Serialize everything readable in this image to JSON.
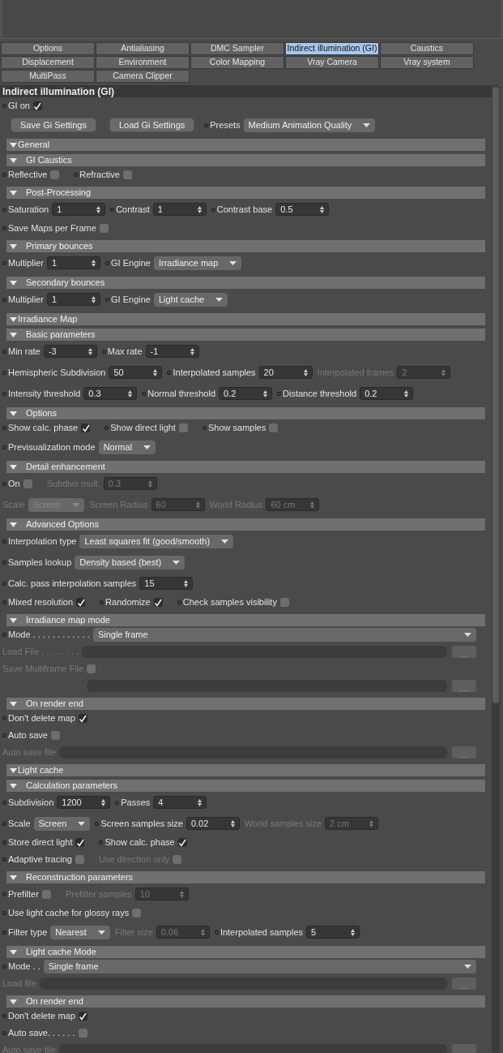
{
  "tabs": [
    {
      "label": "Options",
      "selected": false
    },
    {
      "label": "Antialiasing",
      "selected": false
    },
    {
      "label": "DMC Sampler",
      "selected": false
    },
    {
      "label": "Indirect illumination (GI)",
      "selected": true
    },
    {
      "label": "Caustics",
      "selected": false
    },
    {
      "label": "Displacement",
      "selected": false
    },
    {
      "label": "Environment",
      "selected": false
    },
    {
      "label": "Color Mapping",
      "selected": false
    },
    {
      "label": "Vray Camera",
      "selected": false
    },
    {
      "label": "Vray system",
      "selected": false
    },
    {
      "label": "MultiPass",
      "selected": false
    },
    {
      "label": "Camera Clipper",
      "selected": false
    }
  ],
  "panel_title": "Indirect illumination (GI)",
  "blocks": [
    {
      "kind": "row",
      "items": [
        {
          "kind": "checkbox",
          "label": "GI on",
          "checked": true,
          "disabled": false
        }
      ]
    },
    {
      "kind": "row",
      "items": [
        {
          "kind": "button",
          "label": "Save Gi Settings"
        },
        {
          "kind": "button",
          "label": "Load Gi Settings"
        },
        {
          "kind": "dropdown",
          "label": "Presets",
          "value": "Medium Animation Quality",
          "disabled": false
        }
      ]
    },
    {
      "kind": "group",
      "label": "General"
    },
    {
      "kind": "subgroup",
      "label": "GI Caustics"
    },
    {
      "kind": "row",
      "items": [
        {
          "kind": "checkbox",
          "label": "Reflective",
          "checked": false,
          "disabled": false
        },
        {
          "kind": "checkbox",
          "label": "Refractive",
          "checked": false,
          "disabled": false
        }
      ]
    },
    {
      "kind": "subgroup",
      "label": "Post-Processing"
    },
    {
      "kind": "row",
      "items": [
        {
          "kind": "spinner",
          "label": "Saturation",
          "value": "1",
          "disabled": false
        },
        {
          "kind": "spinner",
          "label": "Contrast",
          "value": "1",
          "disabled": false
        },
        {
          "kind": "spinner",
          "label": "Contrast base",
          "value": "0.5",
          "disabled": false
        }
      ]
    },
    {
      "kind": "row",
      "items": [
        {
          "kind": "checkbox",
          "label": "Save Maps per Frame",
          "checked": false,
          "disabled": false
        }
      ]
    },
    {
      "kind": "subgroup",
      "label": "Primary bounces"
    },
    {
      "kind": "row",
      "items": [
        {
          "kind": "spinner",
          "label": "Multiplier",
          "value": "1",
          "disabled": false
        },
        {
          "kind": "dropdown",
          "label": "GI Engine",
          "value": "Irradiance map",
          "disabled": false
        }
      ]
    },
    {
      "kind": "subgroup",
      "label": "Secondary bounces"
    },
    {
      "kind": "row",
      "items": [
        {
          "kind": "spinner",
          "label": "Multiplier",
          "value": "1",
          "disabled": false
        },
        {
          "kind": "dropdown",
          "label": "GI Engine",
          "value": "Light cache",
          "disabled": false
        }
      ]
    },
    {
      "kind": "group",
      "label": "Irradiance Map"
    },
    {
      "kind": "subgroup",
      "label": "Basic parameters"
    },
    {
      "kind": "row",
      "items": [
        {
          "kind": "spinner",
          "label": "Min rate",
          "value": "-3",
          "disabled": false
        },
        {
          "kind": "spinner",
          "label": "Max rate",
          "value": "-1",
          "disabled": false
        }
      ]
    },
    {
      "kind": "row",
      "items": [
        {
          "kind": "spinner",
          "label": "Hemispheric Subdivision",
          "value": "50",
          "disabled": false
        },
        {
          "kind": "spinner",
          "label": "Interpolated samples",
          "value": "20",
          "disabled": false
        },
        {
          "kind": "spinner",
          "label": "Interpolated frames",
          "value": "2",
          "disabled": true
        }
      ]
    },
    {
      "kind": "row",
      "items": [
        {
          "kind": "spinner",
          "label": "Intensity threshold",
          "value": "0.3",
          "disabled": false
        },
        {
          "kind": "spinner",
          "label": "Normal threshold",
          "value": "0.2",
          "disabled": false
        },
        {
          "kind": "spinner",
          "label": "Distance threshold",
          "value": "0.2",
          "disabled": false
        }
      ]
    },
    {
      "kind": "subgroup",
      "label": "Options"
    },
    {
      "kind": "row",
      "items": [
        {
          "kind": "checkbox",
          "label": "Show calc. phase",
          "checked": true,
          "disabled": false
        },
        {
          "kind": "checkbox",
          "label": "Show direct light",
          "checked": false,
          "disabled": false
        },
        {
          "kind": "checkbox",
          "label": "Show samples",
          "checked": false,
          "disabled": false
        }
      ]
    },
    {
      "kind": "row",
      "items": [
        {
          "kind": "dropdown",
          "label": "Previsualization mode",
          "value": "Normal",
          "disabled": false
        }
      ]
    },
    {
      "kind": "subgroup",
      "label": "Detail enhancement"
    },
    {
      "kind": "row",
      "items": [
        {
          "kind": "checkbox",
          "label": "On",
          "checked": false,
          "disabled": false
        },
        {
          "kind": "spinner",
          "label": "Subdivs mult.",
          "value": "0.3",
          "disabled": true
        }
      ]
    },
    {
      "kind": "row",
      "items": [
        {
          "kind": "dropdown",
          "label": "Scale",
          "value": "Screen",
          "disabled": true
        },
        {
          "kind": "spinner",
          "label": "Screen Radius",
          "value": "60",
          "disabled": true
        },
        {
          "kind": "spinner",
          "label": "World Radius",
          "value": "60 cm",
          "disabled": true
        }
      ]
    },
    {
      "kind": "subgroup",
      "label": "Advanced Options"
    },
    {
      "kind": "row",
      "items": [
        {
          "kind": "dropdown",
          "label": "Interpolation type",
          "value": "Least squares fit (good/smooth)",
          "disabled": false
        }
      ]
    },
    {
      "kind": "row",
      "items": [
        {
          "kind": "dropdown",
          "label": "Samples lookup",
          "value": "Density based (best)",
          "disabled": false
        }
      ]
    },
    {
      "kind": "row",
      "items": [
        {
          "kind": "spinner",
          "label": "Calc. pass interpolation samples",
          "value": "15",
          "disabled": false
        }
      ]
    },
    {
      "kind": "row",
      "items": [
        {
          "kind": "checkbox",
          "label": "Mixed resolution",
          "checked": true,
          "disabled": false
        },
        {
          "kind": "checkbox",
          "label": "Randomize",
          "checked": true,
          "disabled": false
        },
        {
          "kind": "checkbox",
          "label": "Check samples visibility",
          "checked": false,
          "disabled": false
        }
      ]
    },
    {
      "kind": "subgroup",
      "label": "Irradiance map mode"
    },
    {
      "kind": "row",
      "items": [
        {
          "kind": "wide-dropdown",
          "label": "Mode . . . . . . . . . . . .",
          "value": "Single frame",
          "disabled": false
        }
      ]
    },
    {
      "kind": "row",
      "items": [
        {
          "kind": "file",
          "label": "Load File . . . . . . . .",
          "disabled": true
        }
      ]
    },
    {
      "kind": "row",
      "items": [
        {
          "kind": "checkbox",
          "label": "Save Multiframe File",
          "checked": false,
          "disabled": true
        }
      ]
    },
    {
      "kind": "row",
      "items": [
        {
          "kind": "file",
          "disabled": true
        }
      ]
    },
    {
      "kind": "subgroup",
      "label": "On render end"
    },
    {
      "kind": "row",
      "items": [
        {
          "kind": "checkbox",
          "label": "Don't delete map",
          "checked": true,
          "disabled": false
        }
      ]
    },
    {
      "kind": "row",
      "items": [
        {
          "kind": "checkbox",
          "label": "Auto save",
          "checked": false,
          "disabled": false
        }
      ]
    },
    {
      "kind": "row",
      "items": [
        {
          "kind": "file",
          "label": "Auto save file",
          "disabled": true
        }
      ]
    },
    {
      "kind": "group",
      "label": "Light cache"
    },
    {
      "kind": "subgroup",
      "label": "Calculation parameters"
    },
    {
      "kind": "row",
      "items": [
        {
          "kind": "spinner",
          "label": "Subdivision",
          "value": "1200",
          "disabled": false
        },
        {
          "kind": "spinner",
          "label": "Passes",
          "value": "4",
          "disabled": false
        }
      ]
    },
    {
      "kind": "row",
      "items": [
        {
          "kind": "dropdown",
          "label": "Scale",
          "value": "Screen",
          "disabled": false
        },
        {
          "kind": "spinner",
          "label": "Screen samples size",
          "value": "0.02",
          "disabled": false
        },
        {
          "kind": "spinner",
          "label": "World samples size",
          "value": "2 cm",
          "disabled": true
        }
      ]
    },
    {
      "kind": "row",
      "items": [
        {
          "kind": "checkbox",
          "label": "Store direct light",
          "checked": true,
          "disabled": false
        },
        {
          "kind": "checkbox",
          "label": "Show calc. phase",
          "checked": true,
          "disabled": false
        }
      ]
    },
    {
      "kind": "row",
      "items": [
        {
          "kind": "checkbox",
          "label": "Adaptive tracing",
          "checked": false,
          "disabled": false
        },
        {
          "kind": "checkbox",
          "label": "Use direction only",
          "checked": false,
          "disabled": true
        }
      ]
    },
    {
      "kind": "subgroup",
      "label": "Reconstruction parameters"
    },
    {
      "kind": "row",
      "items": [
        {
          "kind": "checkbox",
          "label": "Prefilter",
          "checked": false,
          "disabled": false
        },
        {
          "kind": "spinner",
          "label": "Prefilter samples",
          "value": "10",
          "disabled": true
        }
      ]
    },
    {
      "kind": "row",
      "items": [
        {
          "kind": "checkbox",
          "label": "Use light cache for glossy rays",
          "checked": false,
          "disabled": false
        }
      ]
    },
    {
      "kind": "row",
      "items": [
        {
          "kind": "dropdown",
          "label": "Filter type",
          "value": "Nearest",
          "disabled": false
        },
        {
          "kind": "spinner",
          "label": "Filter size",
          "value": "0.06",
          "disabled": true
        },
        {
          "kind": "spinner",
          "label": "Interpolated samples",
          "value": "5",
          "disabled": false
        }
      ]
    },
    {
      "kind": "subgroup",
      "label": "Light cache Mode"
    },
    {
      "kind": "row",
      "items": [
        {
          "kind": "wide-dropdown",
          "label": "Mode . .",
          "value": "Single frame",
          "disabled": false
        }
      ]
    },
    {
      "kind": "row",
      "items": [
        {
          "kind": "file",
          "label": "Load file",
          "disabled": true
        }
      ]
    },
    {
      "kind": "subgroup",
      "label": "On render end"
    },
    {
      "kind": "row",
      "items": [
        {
          "kind": "checkbox",
          "label": "Don't delete map",
          "checked": true,
          "disabled": false
        }
      ]
    },
    {
      "kind": "row",
      "items": [
        {
          "kind": "checkbox",
          "label": "Auto save. . . . . .",
          "checked": false,
          "disabled": false
        }
      ]
    },
    {
      "kind": "row",
      "items": [
        {
          "kind": "file",
          "label": "Auto save file",
          "disabled": true
        }
      ]
    }
  ]
}
